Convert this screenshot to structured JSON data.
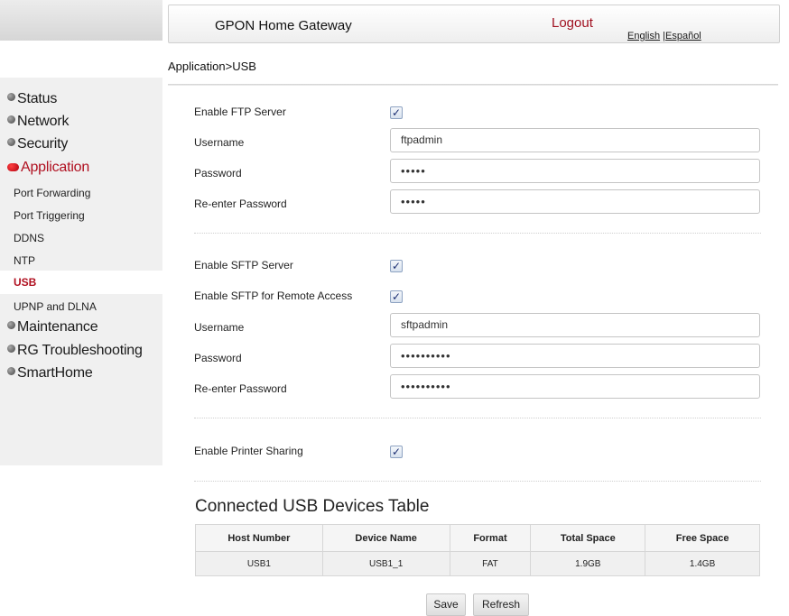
{
  "header": {
    "title": "GPON Home Gateway",
    "logout": "Logout",
    "lang_english": "English",
    "lang_separator": " |",
    "lang_spanish": "Español"
  },
  "breadcrumb": "Application>USB",
  "sidebar": {
    "items": [
      {
        "label": "Status"
      },
      {
        "label": "Network"
      },
      {
        "label": "Security"
      },
      {
        "label": "Application",
        "active": true
      },
      {
        "label": "Maintenance"
      },
      {
        "label": "RG Troubleshooting"
      },
      {
        "label": "SmartHome"
      }
    ],
    "subitems": [
      {
        "label": "Port Forwarding"
      },
      {
        "label": "Port Triggering"
      },
      {
        "label": "DDNS"
      },
      {
        "label": "NTP"
      },
      {
        "label": "USB",
        "current": true
      },
      {
        "label": "UPNP and DLNA"
      }
    ]
  },
  "ftp": {
    "enable_label": "Enable FTP Server",
    "enabled": true,
    "username_label": "Username",
    "username_value": "ftpadmin",
    "password_label": "Password",
    "password_value": "•••••",
    "reenter_label": "Re-enter Password",
    "reenter_value": "•••••"
  },
  "sftp": {
    "enable_label": "Enable SFTP Server",
    "enabled": true,
    "remote_label": "Enable SFTP for Remote Access",
    "remote_enabled": true,
    "username_label": "Username",
    "username_value": "sftpadmin",
    "password_label": "Password",
    "password_value": "••••••••••",
    "reenter_label": "Re-enter Password",
    "reenter_value": "••••••••••"
  },
  "printer": {
    "enable_label": "Enable Printer Sharing",
    "enabled": true
  },
  "checkmark": "✓",
  "usb_table": {
    "title": "Connected USB Devices Table",
    "columns": [
      "Host Number",
      "Device Name",
      "Format",
      "Total Space",
      "Free Space"
    ],
    "rows": [
      [
        "USB1",
        "USB1_1",
        "FAT",
        "1.9GB",
        "1.4GB"
      ]
    ]
  },
  "buttons": {
    "save": "Save",
    "refresh": "Refresh"
  },
  "colors": {
    "accent": "#b01020",
    "sidebar_bg": "#f0f0f0"
  }
}
